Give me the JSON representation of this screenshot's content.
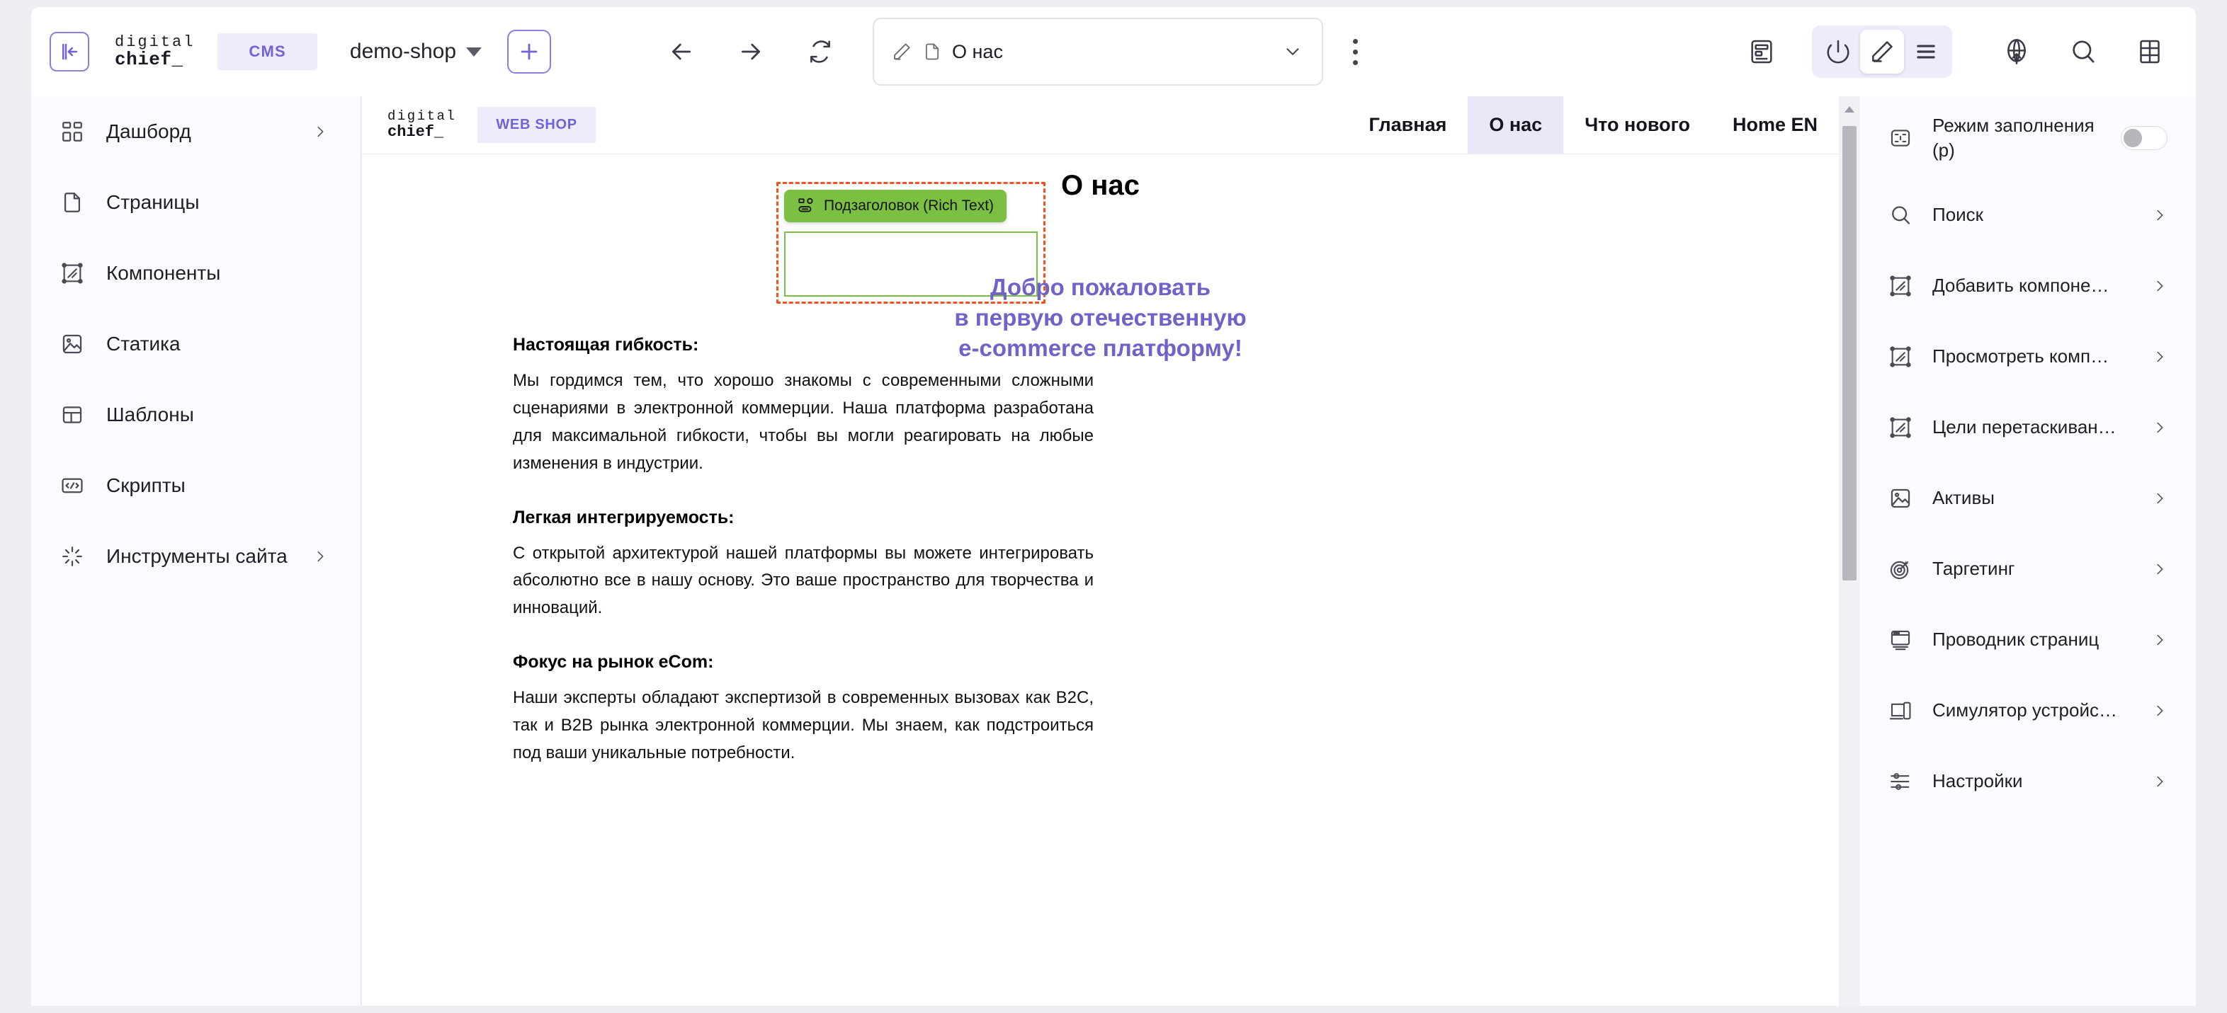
{
  "toolbar": {
    "collapse_icon": "panel-collapse-icon",
    "brand_line1": "digital",
    "brand_line2": "chief_",
    "cms_chip": "CMS",
    "project": "demo-shop",
    "add_label": "+",
    "back_icon": "arrow-left-icon",
    "forward_icon": "arrow-right-icon",
    "reload_icon": "reload-icon",
    "url_value": "О нас",
    "url_pencil_icon": "pencil-icon",
    "url_page_icon": "page-icon",
    "url_chevron_icon": "chevron-down-icon",
    "kebab_icon": "more-vertical-icon",
    "right_icons": [
      {
        "name": "layout-panel-icon"
      },
      {
        "name": "power-icon"
      },
      {
        "name": "pencil-icon"
      },
      {
        "name": "list-icon"
      },
      {
        "name": "publish-globe-icon"
      },
      {
        "name": "search-icon"
      },
      {
        "name": "grid-icon"
      }
    ]
  },
  "sidebar": {
    "items": [
      {
        "label": "Дашборд",
        "icon": "dashboard-icon",
        "chevron": true
      },
      {
        "label": "Страницы",
        "icon": "page-icon",
        "chevron": false
      },
      {
        "label": "Компоненты",
        "icon": "component-icon",
        "chevron": false
      },
      {
        "label": "Статика",
        "icon": "image-icon",
        "chevron": false
      },
      {
        "label": "Шаблоны",
        "icon": "template-icon",
        "chevron": false
      },
      {
        "label": "Скрипты",
        "icon": "code-icon",
        "chevron": false
      },
      {
        "label": "Инструменты сайта",
        "icon": "tools-icon",
        "chevron": true
      }
    ]
  },
  "site": {
    "brand_line1": "digital",
    "brand_line2": "chief_",
    "shop_chip": "WEB SHOP",
    "menu": [
      {
        "label": "Главная",
        "active": false
      },
      {
        "label": "О нас",
        "active": true
      },
      {
        "label": "Что нового",
        "active": false
      },
      {
        "label": "Home EN",
        "active": false
      }
    ]
  },
  "page": {
    "heading": "О нас",
    "selection_badge": "Подзаголовок (Rich Text)",
    "selection_badge_icon": "rich-text-icon",
    "hero_lines": [
      "Добро пожаловать",
      "в первую отечественную",
      "e-commerce платформу!"
    ],
    "sections": [
      {
        "heading": "Настоящая гибкость:",
        "text": "Мы гордимся тем, что хорошо знакомы с современными сложными сценариями в электронной коммерции. Наша платформа разработана для максимальной гибкости, чтобы вы могли реагировать на любые изменения в индустрии."
      },
      {
        "heading": "Легкая интегрируемость:",
        "text": "С открытой архитектурой нашей платформы вы можете интегрировать абсолютно все в нашу основу. Это ваше пространство для творчества и инноваций."
      },
      {
        "heading": "Фокус на рынок eCom:",
        "text": "Наши эксперты обладают экспертизой в современных вызовах как B2C, так и B2B рынка электронной коммерции. Мы знаем, как подстроиться под ваши уникальные потребности."
      }
    ]
  },
  "rightpanel": {
    "items": [
      {
        "label": "Режим заполнения (p)",
        "icon": "fill-mode-icon",
        "control": "toggle",
        "toggle_on": false
      },
      {
        "label": "Поиск",
        "icon": "search-icon",
        "control": "chevron"
      },
      {
        "label": "Добавить компоне…",
        "icon": "component-icon",
        "control": "chevron"
      },
      {
        "label": "Просмотреть комп…",
        "icon": "component-icon",
        "control": "chevron"
      },
      {
        "label": "Цели перетаскиван…",
        "icon": "component-icon",
        "control": "chevron"
      },
      {
        "label": "Активы",
        "icon": "image-icon",
        "control": "chevron"
      },
      {
        "label": "Таргетинг",
        "icon": "target-icon",
        "control": "chevron"
      },
      {
        "label": "Проводник страниц",
        "icon": "monitor-icon",
        "control": "chevron"
      },
      {
        "label": "Симулятор устройс…",
        "icon": "devices-icon",
        "control": "chevron"
      },
      {
        "label": "Настройки",
        "icon": "settings-sliders-icon",
        "control": "chevron"
      }
    ]
  },
  "colors": {
    "accent_purple": "#6f63d6",
    "chip_bg": "#eeecfb",
    "selection_red": "#f4511e",
    "selection_green": "#7cc043",
    "hero_purple": "#6f63c9"
  }
}
